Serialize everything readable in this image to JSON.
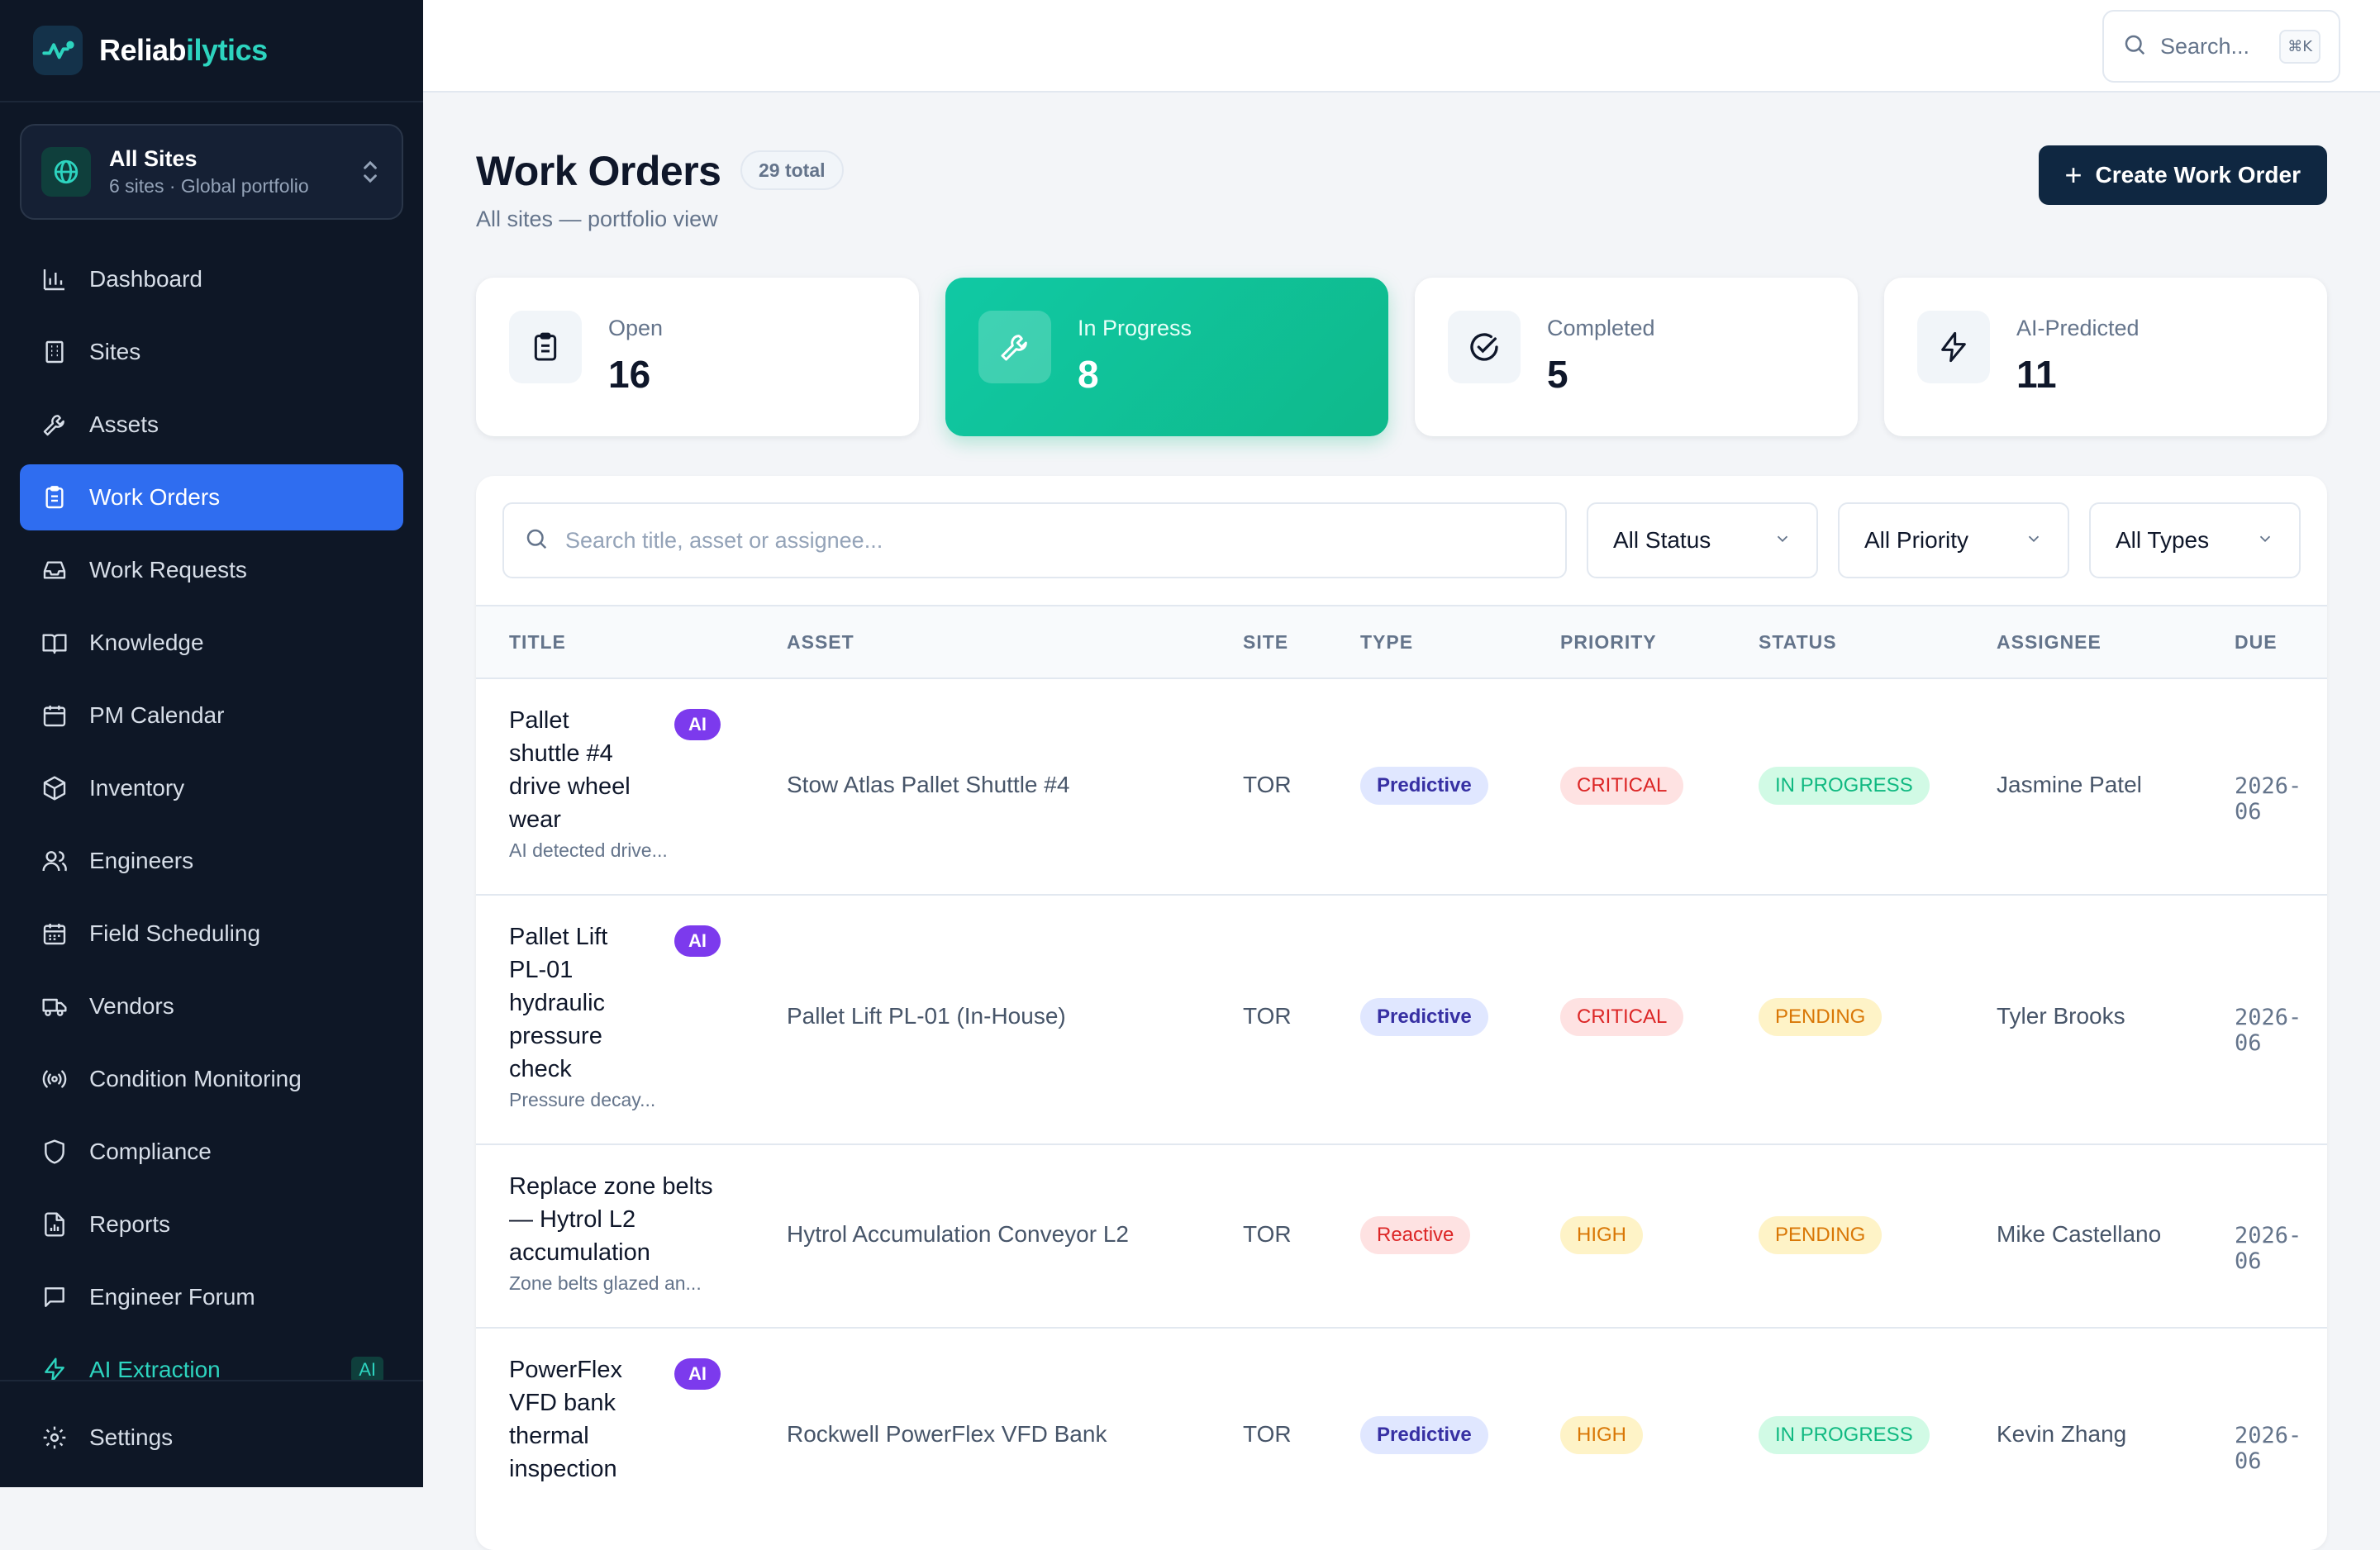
{
  "app": {
    "name_main": "Reliab",
    "name_accent": "ilytics"
  },
  "site_switcher": {
    "title": "All Sites",
    "subtitle": "6 sites · Global portfolio"
  },
  "sidebar": {
    "items": [
      {
        "label": "Dashboard",
        "icon": "bar-chart-icon"
      },
      {
        "label": "Sites",
        "icon": "building-icon"
      },
      {
        "label": "Assets",
        "icon": "wrench-icon"
      },
      {
        "label": "Work Orders",
        "icon": "clipboard-icon",
        "active": true
      },
      {
        "label": "Work Requests",
        "icon": "inbox-icon"
      },
      {
        "label": "Knowledge",
        "icon": "book-icon"
      },
      {
        "label": "PM Calendar",
        "icon": "calendar-icon"
      },
      {
        "label": "Inventory",
        "icon": "box-icon"
      },
      {
        "label": "Engineers",
        "icon": "users-icon"
      },
      {
        "label": "Field Scheduling",
        "icon": "calendar-grid-icon"
      },
      {
        "label": "Vendors",
        "icon": "truck-icon"
      },
      {
        "label": "Condition Monitoring",
        "icon": "radio-icon"
      },
      {
        "label": "Compliance",
        "icon": "shield-icon"
      },
      {
        "label": "Reports",
        "icon": "file-chart-icon"
      },
      {
        "label": "Engineer Forum",
        "icon": "chat-icon"
      },
      {
        "label": "AI Extraction",
        "icon": "lightning-icon",
        "badge": "AI"
      }
    ],
    "settings": "Settings"
  },
  "topbar": {
    "search_label": "Search...",
    "shortcut": "⌘K"
  },
  "page": {
    "title": "Work Orders",
    "count": "29 total",
    "subtitle": "All sites — portfolio view",
    "create_label": "Create Work Order"
  },
  "stats": [
    {
      "label": "Open",
      "value": "16",
      "icon": "clipboard-icon"
    },
    {
      "label": "In Progress",
      "value": "8",
      "icon": "wrench-icon"
    },
    {
      "label": "Completed",
      "value": "5",
      "icon": "check-circle-icon"
    },
    {
      "label": "AI-Predicted",
      "value": "11",
      "icon": "lightning-icon"
    }
  ],
  "filters": {
    "search_placeholder": "Search title, asset or assignee...",
    "status": "All Status",
    "priority": "All Priority",
    "type": "All Types"
  },
  "table": {
    "headers": [
      "TITLE",
      "ASSET",
      "SITE",
      "TYPE",
      "PRIORITY",
      "STATUS",
      "ASSIGNEE",
      "DUE"
    ],
    "rows": [
      {
        "title_lines": [
          "Pallet",
          "shuttle #4",
          "drive wheel",
          "wear"
        ],
        "desc": "AI detected drive...",
        "ai": "AI",
        "asset": "Stow Atlas Pallet Shuttle #4",
        "site": "TOR",
        "type": "Predictive",
        "priority": "CRITICAL",
        "status": "IN PROGRESS",
        "assignee": "Jasmine Patel",
        "due": "2026-06"
      },
      {
        "title_lines": [
          "Pallet Lift",
          "PL-01",
          "hydraulic",
          "pressure",
          "check"
        ],
        "desc": "Pressure decay...",
        "ai": "AI",
        "asset": "Pallet Lift PL-01 (In-House)",
        "site": "TOR",
        "type": "Predictive",
        "priority": "CRITICAL",
        "status": "PENDING",
        "assignee": "Tyler Brooks",
        "due": "2026-06"
      },
      {
        "title_lines": [
          "Replace zone belts",
          "— Hytrol L2",
          "accumulation"
        ],
        "desc": "Zone belts glazed an...",
        "ai": "",
        "asset": "Hytrol Accumulation Conveyor L2",
        "site": "TOR",
        "type": "Reactive",
        "priority": "HIGH",
        "status": "PENDING",
        "assignee": "Mike Castellano",
        "due": "2026-06"
      },
      {
        "title_lines": [
          "PowerFlex",
          "VFD bank",
          "thermal",
          "inspection"
        ],
        "desc": "",
        "ai": "AI",
        "asset": "Rockwell PowerFlex VFD Bank",
        "site": "TOR",
        "type": "Predictive",
        "priority": "HIGH",
        "status": "IN PROGRESS",
        "assignee": "Kevin Zhang",
        "due": "2026-06"
      }
    ]
  }
}
